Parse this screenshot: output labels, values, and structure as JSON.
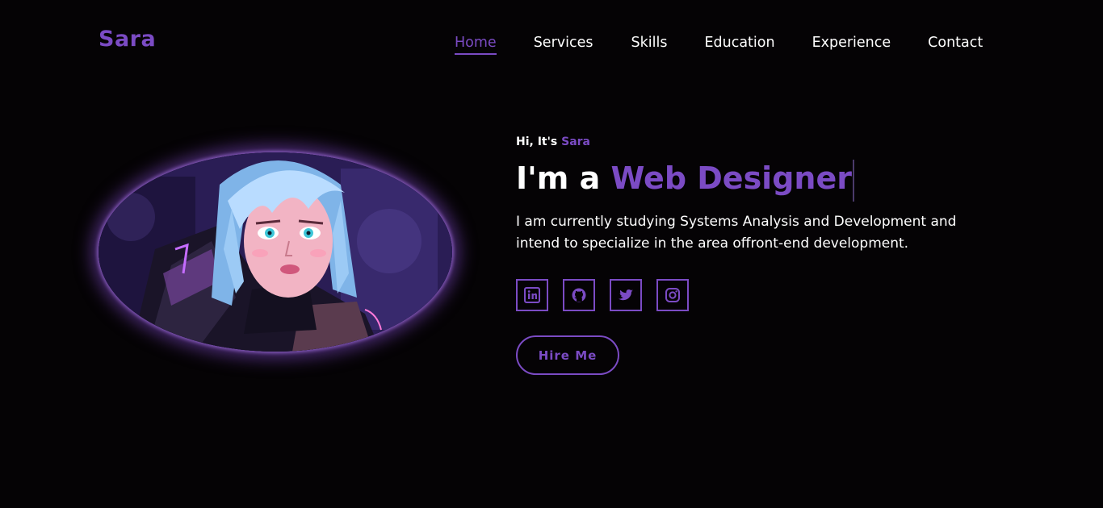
{
  "brand": {
    "logo": "Sara"
  },
  "nav": {
    "items": [
      {
        "label": "Home",
        "active": true
      },
      {
        "label": "Services",
        "active": false
      },
      {
        "label": "Skills",
        "active": false
      },
      {
        "label": "Education",
        "active": false
      },
      {
        "label": "Experience",
        "active": false
      },
      {
        "label": "Contact",
        "active": false
      }
    ]
  },
  "hero": {
    "greeting_prefix": "Hi, It's",
    "greeting_name": "Sara",
    "headline_prefix": "I'm a",
    "headline_role": "Web Designer",
    "description": "I am currently studying Systems Analysis and Development and intend to specialize in the area offront-end development.",
    "hire_label": "Hire Me"
  },
  "socials": [
    {
      "icon": "linkedin-icon"
    },
    {
      "icon": "github-icon"
    },
    {
      "icon": "twitter-icon"
    },
    {
      "icon": "instagram-icon"
    }
  ],
  "colors": {
    "accent": "#7b4bc4",
    "background": "#050305",
    "text": "#ffffff"
  }
}
